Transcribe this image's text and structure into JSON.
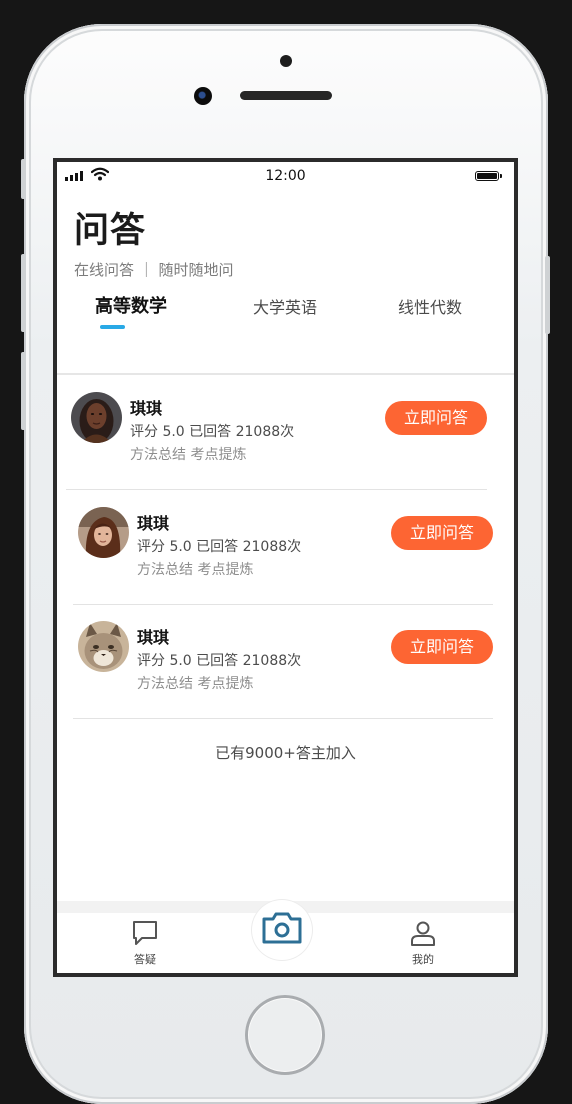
{
  "status_bar": {
    "time": "12:00"
  },
  "header": {
    "title": "问答",
    "subtitle": "在线问答 ｜ 随时随地问"
  },
  "tabs": [
    {
      "label": "高等数学",
      "active": true
    },
    {
      "label": "大学英语",
      "active": false
    },
    {
      "label": "线性代数",
      "active": false
    }
  ],
  "experts": [
    {
      "name": "琪琪",
      "rating": "评分 5.0 已回答 21088次",
      "tags": "方法总结 考点提炼",
      "button": "立即问答",
      "avatar": "woman-portrait"
    },
    {
      "name": "琪琪",
      "rating": "评分 5.0 已回答 21088次",
      "tags": "方法总结 考点提炼",
      "button": "立即问答",
      "avatar": "woman-brown-hair"
    },
    {
      "name": "琪琪",
      "rating": "评分 5.0 已回答 21088次",
      "tags": "方法总结 考点提炼",
      "button": "立即问答",
      "avatar": "lynx"
    }
  ],
  "footer_note": "已有9000+答主加入",
  "tab_bar": {
    "items": [
      {
        "label": "答疑",
        "icon": "chat-bubble-icon"
      },
      {
        "label": "",
        "icon": "camera-icon"
      },
      {
        "label": "我的",
        "icon": "person-icon"
      }
    ]
  },
  "colors": {
    "accent_button": "#fd6533",
    "tab_indicator": "#29a9e6",
    "camera_icon": "#2d6f95"
  }
}
